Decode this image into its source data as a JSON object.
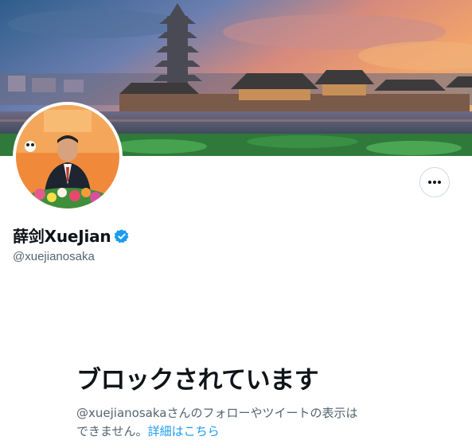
{
  "profile": {
    "display_name": "薛剑XueJian",
    "handle": "@xuejianosaka",
    "verified": true,
    "verified_icon": "verified-badge-icon",
    "more_icon": "more-horizontal-icon"
  },
  "blocked": {
    "title": "ブロックされています",
    "description_line1": "@xuejianosakaさんのフォローやツイートの表示は",
    "description_line2": "できません。",
    "learn_more": "詳細はこちら"
  },
  "colors": {
    "accent": "#1d9bf0",
    "text_primary": "#0f1419",
    "text_secondary": "#536471",
    "border": "#cfd9de"
  }
}
